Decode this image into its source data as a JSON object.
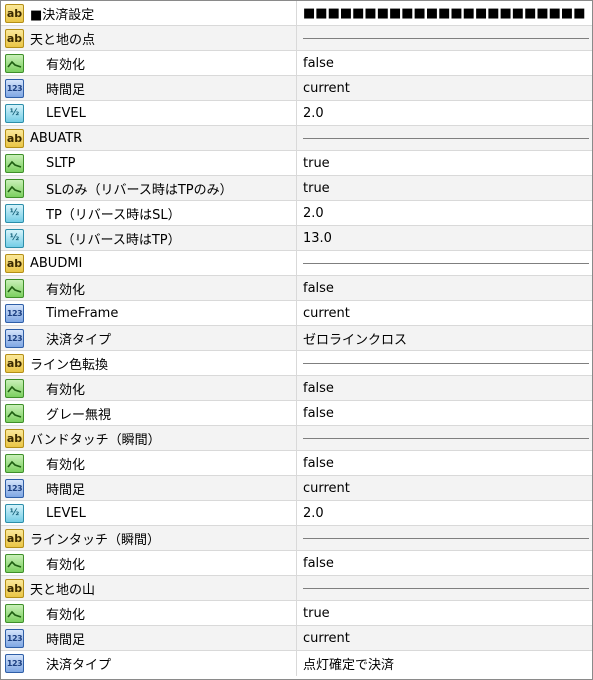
{
  "rows": [
    {
      "type": "string",
      "icon": "ab",
      "label": "■決済設定",
      "value": "■■■■■■■■■■■■■■■■■■■■■■■",
      "child": false
    },
    {
      "type": "string",
      "icon": "ab",
      "label": "天と地の点",
      "value": null,
      "child": false
    },
    {
      "type": "bool",
      "icon": "bool",
      "label": "有効化",
      "value": "false",
      "child": true
    },
    {
      "type": "int",
      "icon": "123",
      "label": "時間足",
      "value": "current",
      "child": true
    },
    {
      "type": "double",
      "icon": "v2",
      "label": "LEVEL",
      "value": "2.0",
      "child": true
    },
    {
      "type": "string",
      "icon": "ab",
      "label": "ABUATR",
      "value": null,
      "child": false
    },
    {
      "type": "bool",
      "icon": "bool",
      "label": "SLTP",
      "value": "true",
      "child": true
    },
    {
      "type": "bool",
      "icon": "bool",
      "label": "SLのみ（リバース時はTPのみ）",
      "value": "true",
      "child": true
    },
    {
      "type": "double",
      "icon": "v2",
      "label": "TP（リバース時はSL）",
      "value": "2.0",
      "child": true
    },
    {
      "type": "double",
      "icon": "v2",
      "label": "SL（リバース時はTP）",
      "value": "13.0",
      "child": true
    },
    {
      "type": "string",
      "icon": "ab",
      "label": "ABUDMI",
      "value": null,
      "child": false
    },
    {
      "type": "bool",
      "icon": "bool",
      "label": "有効化",
      "value": "false",
      "child": true
    },
    {
      "type": "int",
      "icon": "123",
      "label": "TimeFrame",
      "value": "current",
      "child": true
    },
    {
      "type": "int",
      "icon": "123",
      "label": "決済タイプ",
      "value": "ゼロラインクロス",
      "child": true
    },
    {
      "type": "string",
      "icon": "ab",
      "label": "ライン色転換",
      "value": null,
      "child": false
    },
    {
      "type": "bool",
      "icon": "bool",
      "label": "有効化",
      "value": "false",
      "child": true
    },
    {
      "type": "bool",
      "icon": "bool",
      "label": "グレー無視",
      "value": "false",
      "child": true
    },
    {
      "type": "string",
      "icon": "ab",
      "label": "バンドタッチ（瞬間）",
      "value": null,
      "child": false
    },
    {
      "type": "bool",
      "icon": "bool",
      "label": "有効化",
      "value": "false",
      "child": true
    },
    {
      "type": "int",
      "icon": "123",
      "label": "時間足",
      "value": "current",
      "child": true
    },
    {
      "type": "double",
      "icon": "v2",
      "label": "LEVEL",
      "value": "2.0",
      "child": true
    },
    {
      "type": "string",
      "icon": "ab",
      "label": "ラインタッチ（瞬間）",
      "value": null,
      "child": false
    },
    {
      "type": "bool",
      "icon": "bool",
      "label": "有効化",
      "value": "false",
      "child": true
    },
    {
      "type": "string",
      "icon": "ab",
      "label": "天と地の山",
      "value": null,
      "child": false
    },
    {
      "type": "bool",
      "icon": "bool",
      "label": "有効化",
      "value": "true",
      "child": true
    },
    {
      "type": "int",
      "icon": "123",
      "label": "時間足",
      "value": "current",
      "child": true
    },
    {
      "type": "int",
      "icon": "123",
      "label": "決済タイプ",
      "value": "点灯確定で決済",
      "child": true
    }
  ],
  "icon_text": {
    "ab": "ab",
    "123": "123",
    "v2": "½"
  }
}
